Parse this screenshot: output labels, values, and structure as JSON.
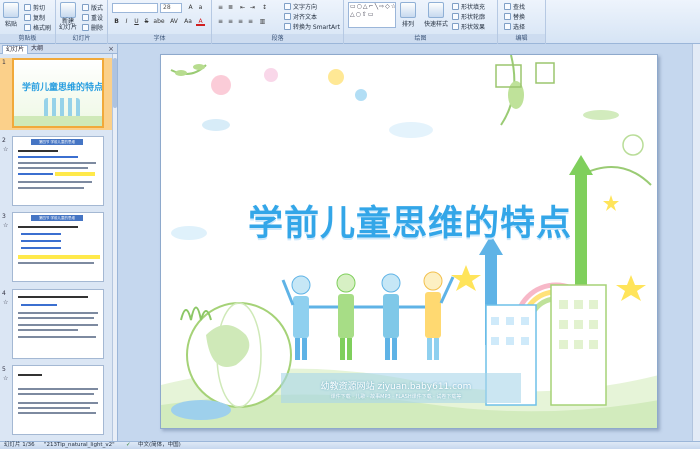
{
  "ribbon": {
    "clipboard": {
      "label": "剪贴板",
      "paste": "粘贴",
      "cut": "剪切",
      "copy": "复制",
      "format": "格式刷"
    },
    "slides": {
      "label": "幻灯片",
      "new_slide": "新建\n幻灯片",
      "layout": "版式",
      "reset": "重设",
      "delete": "删除"
    },
    "font": {
      "label": "字体",
      "font_name": "",
      "font_size": "28",
      "bold": "B",
      "italic": "I",
      "underline": "U",
      "strike": "S",
      "shadow": "abe",
      "spacing": "AV",
      "case": "Aa",
      "color": "A"
    },
    "paragraph": {
      "label": "段落",
      "text_direction": "文字方向",
      "align_text": "对齐文本",
      "smartart": "转换为 SmartArt"
    },
    "drawing": {
      "label": "绘图",
      "arrange": "排列",
      "quick_styles": "快速样式",
      "fill": "形状填充",
      "outline": "形状轮廓",
      "effects": "形状效果"
    },
    "editing": {
      "label": "编辑",
      "find": "查找",
      "replace": "替换",
      "select": "选择"
    }
  },
  "left_panel": {
    "tab_slides": "幻灯片",
    "tab_outline": "大纲",
    "close": "×",
    "thumbnails": [
      {
        "number": "1",
        "star": "",
        "title": "学前儿童思维的特点"
      },
      {
        "number": "2",
        "star": "☆",
        "title": "第四节 学前儿童的思维"
      },
      {
        "number": "3",
        "star": "☆",
        "title": "第四节 学前儿童的思维"
      },
      {
        "number": "4",
        "star": "☆",
        "title": ""
      },
      {
        "number": "5",
        "star": "☆",
        "title": ""
      }
    ]
  },
  "slide": {
    "title": "学前儿童思维的特点",
    "site": "幼教资源网站 ziyuan.baby611.com",
    "sub": "课件下载 · 儿歌 · 故事MP3 · FLASH课件下载 · 试卷下载等"
  },
  "status_bar": {
    "slide_info": "幻灯片 1/36",
    "theme": "\"213Tip_natural_light_v2\"",
    "check": "✓",
    "language": "中文(简体，中国)"
  },
  "colors": {
    "title_blue": "#33a6e8",
    "ribbon_bg": "#d6e4f5",
    "selected_thumb": "#fbd08a"
  }
}
